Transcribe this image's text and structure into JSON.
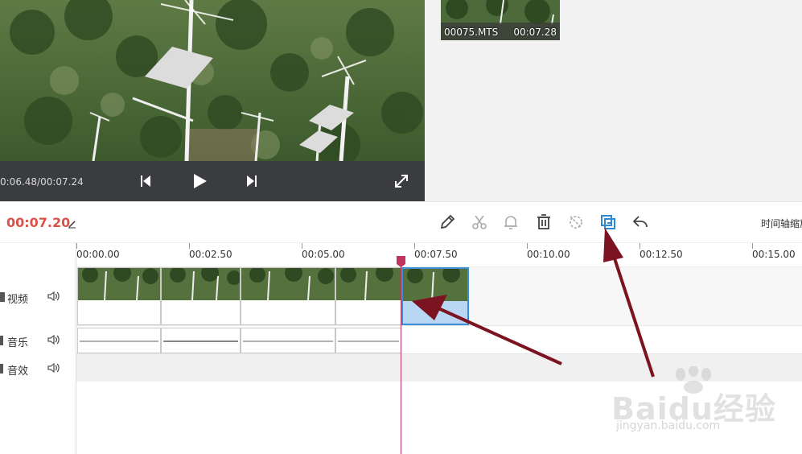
{
  "preview": {
    "time_readout": "0:06.48/00:07.24",
    "icons": {
      "prev": "skip-previous-icon",
      "play": "play-icon",
      "next": "skip-next-icon",
      "fullscreen": "fullscreen-icon"
    }
  },
  "media_bin": {
    "clip": {
      "name": "00075.MTS",
      "duration": "00:07.28"
    }
  },
  "toolbar": {
    "current_time": "00:07.20",
    "zoom_label": "时间轴缩放",
    "tools": [
      "edit-icon",
      "split-icon",
      "alarm-icon",
      "delete-icon",
      "freeze-icon",
      "copy-icon",
      "undo-icon"
    ],
    "accent_color": "#2f8ad8"
  },
  "timeline": {
    "ruler": [
      "00:00.00",
      "00:02.50",
      "00:05.00",
      "00:07.50",
      "00:10.00",
      "00:12.50",
      "00:15.00"
    ],
    "tracks": [
      {
        "label": "视频"
      },
      {
        "label": "音乐"
      },
      {
        "label": "音效"
      }
    ],
    "playhead_color": "#c0335a",
    "selected_clip_color": "#3c8fd9"
  },
  "watermark": {
    "brand": "Baidu经验",
    "url": "jingyan.baidu.com"
  }
}
